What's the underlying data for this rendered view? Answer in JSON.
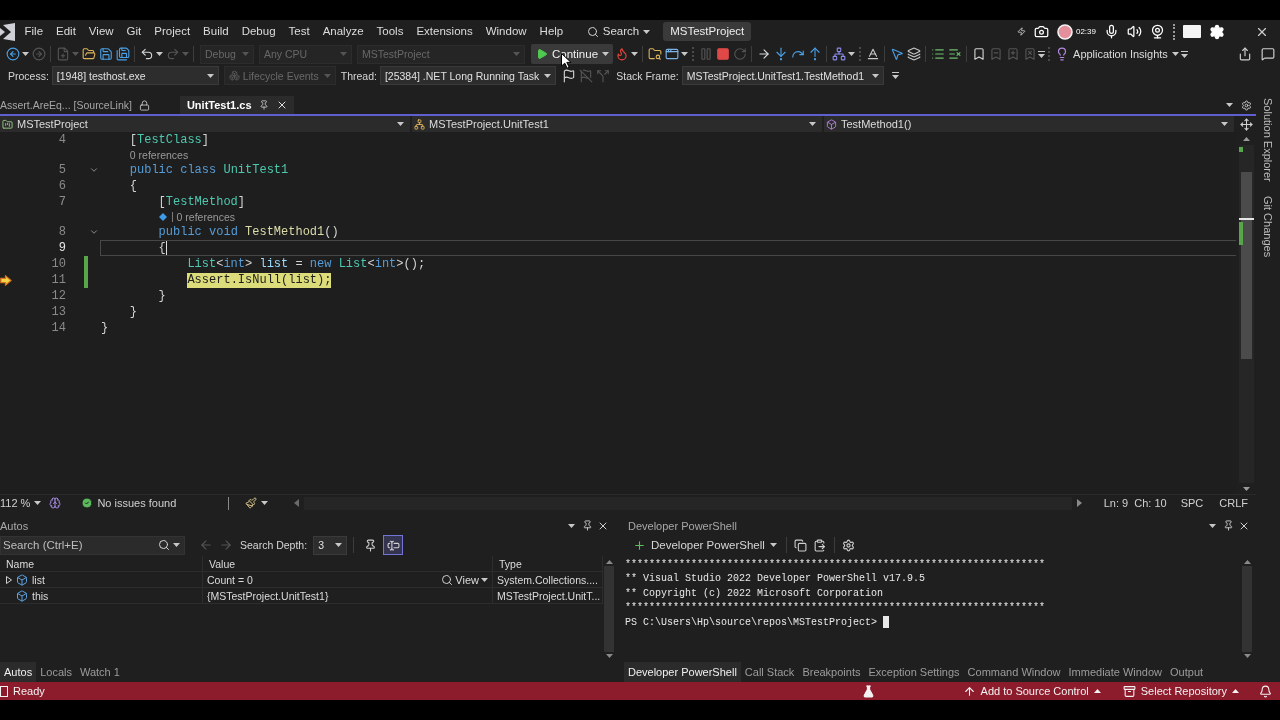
{
  "menu_bar": {
    "items": [
      "File",
      "Edit",
      "View",
      "Git",
      "Project",
      "Build",
      "Debug",
      "Test",
      "Analyze",
      "Tools",
      "Extensions",
      "Window",
      "Help"
    ],
    "search": "Search",
    "title": "MSTestProject"
  },
  "recorder": {
    "time": "02:39"
  },
  "toolbar": {
    "nav_groups": [
      [
        {
          "kind": "back",
          "dropdown": true,
          "disabled": false
        },
        {
          "kind": "forward",
          "disabled": true
        }
      ],
      [
        {
          "kind": "new",
          "dropdown": true,
          "disabled": true
        },
        {
          "kind": "open",
          "disabled": false
        },
        {
          "kind": "save",
          "disabled": false
        },
        {
          "kind": "save_all",
          "disabled": false
        }
      ],
      [
        {
          "kind": "undo",
          "dropdown": true,
          "disabled": false
        },
        {
          "kind": "redo",
          "dropdown": true,
          "disabled": true
        }
      ]
    ],
    "combos": [
      {
        "value": "Debug",
        "disabled": true
      },
      {
        "value": "Any CPU",
        "disabled": true
      },
      {
        "value": "MSTestProject",
        "disabled": true
      }
    ],
    "continue": "Continue",
    "debug_groups": [
      [
        {
          "kind": "hot_reload",
          "dropdown": true,
          "disabled": false
        }
      ],
      [
        {
          "kind": "browse",
          "disabled": false
        },
        {
          "kind": "window",
          "dropdown": true,
          "disabled": false
        }
      ],
      [
        {
          "kind": "pause",
          "disabled": true
        },
        {
          "kind": "stop",
          "disabled": false
        },
        {
          "kind": "restart",
          "disabled": true
        }
      ],
      [
        {
          "kind": "next_statement",
          "disabled": false
        },
        {
          "kind": "step_into",
          "disabled": false
        },
        {
          "kind": "step_over",
          "disabled": false
        },
        {
          "kind": "step_out",
          "disabled": false
        }
      ],
      [
        {
          "kind": "map",
          "dropdown": true,
          "disabled": false
        }
      ],
      [
        {
          "kind": "spell",
          "disabled": false
        }
      ],
      [
        {
          "kind": "pointer",
          "disabled": false
        },
        {
          "kind": "stack",
          "disabled": false
        }
      ],
      [
        {
          "kind": "comment",
          "disabled": false
        },
        {
          "kind": "uncomment",
          "disabled": false
        }
      ],
      [
        {
          "kind": "bookmark",
          "disabled": false
        },
        {
          "kind": "bookmark_prev",
          "disabled": true
        },
        {
          "kind": "bookmark_next",
          "disabled": true
        },
        {
          "kind": "bookmark_clear",
          "disabled": true
        }
      ]
    ],
    "insights": "Application Insights"
  },
  "debug_location": {
    "process_label": "Process:",
    "process": "[1948] testhost.exe",
    "lifecycle": {
      "label": "Lifecycle Events",
      "disabled": true
    },
    "thread_label": "Thread:",
    "thread": "[25384] .NET Long Running Task",
    "thread_buttons": [
      {
        "kind": "flag",
        "disabled": false
      },
      {
        "kind": "flag_threads",
        "disabled": true
      },
      {
        "kind": "threads",
        "disabled": true
      }
    ],
    "frame_label": "Stack Frame:",
    "frame": "MSTestProject.UnitTest1.TestMethod1"
  },
  "document_tabs": [
    {
      "label": "Assert.AreEq... [SourceLink]",
      "selected": false,
      "read_only": true
    },
    {
      "label": "UnitTest1.cs",
      "selected": true,
      "read_only": false
    }
  ],
  "navigation_bar": {
    "project": "MSTestProject",
    "type": "MSTestProject.UnitTest1",
    "member": "TestMethod1()"
  },
  "editor": {
    "lines": [
      {
        "kind": "code",
        "number": "4",
        "tokens": [
          {
            "kind": "punct",
            "text": "    ["
          },
          {
            "kind": "type",
            "text": "TestClass"
          },
          {
            "kind": "punct",
            "text": "]"
          }
        ],
        "fold": false,
        "changed": false,
        "current": false,
        "caret": false
      },
      {
        "kind": "lens",
        "text": "0 references",
        "test": false
      },
      {
        "kind": "code",
        "number": "5",
        "tokens": [
          {
            "kind": "keyword",
            "text": "    public "
          },
          {
            "kind": "keyword",
            "text": "class "
          },
          {
            "kind": "type",
            "text": "UnitTest1"
          }
        ],
        "fold": true,
        "changed": false,
        "current": false,
        "caret": false
      },
      {
        "kind": "code",
        "number": "6",
        "tokens": [
          {
            "kind": "punct",
            "text": "    {"
          }
        ],
        "fold": false,
        "changed": false,
        "current": false,
        "caret": false
      },
      {
        "kind": "code",
        "number": "7",
        "tokens": [
          {
            "kind": "punct",
            "text": "        ["
          },
          {
            "kind": "type",
            "text": "TestMethod"
          },
          {
            "kind": "punct",
            "text": "]"
          }
        ],
        "fold": false,
        "changed": false,
        "current": false,
        "caret": false
      },
      {
        "kind": "lens",
        "text": "0 references",
        "test": true
      },
      {
        "kind": "code",
        "number": "8",
        "tokens": [
          {
            "kind": "keyword",
            "text": "        public "
          },
          {
            "kind": "keyword",
            "text": "void "
          },
          {
            "kind": "method",
            "text": "TestMethod1"
          },
          {
            "kind": "punct",
            "text": "()"
          }
        ],
        "fold": true,
        "changed": false,
        "current": false,
        "caret": false
      },
      {
        "kind": "code",
        "number": "9",
        "tokens": [
          {
            "kind": "punct",
            "text": "        {"
          }
        ],
        "fold": false,
        "changed": false,
        "current": false,
        "caret": true
      },
      {
        "kind": "code",
        "number": "10",
        "tokens": [
          {
            "kind": "type",
            "text": "            List"
          },
          {
            "kind": "punct",
            "text": "<"
          },
          {
            "kind": "keyword",
            "text": "int"
          },
          {
            "kind": "punct",
            "text": "> "
          },
          {
            "kind": "variable",
            "text": "list"
          },
          {
            "kind": "punct",
            "text": " = "
          },
          {
            "kind": "keyword",
            "text": "new "
          },
          {
            "kind": "type",
            "text": "List"
          },
          {
            "kind": "punct",
            "text": "<"
          },
          {
            "kind": "keyword",
            "text": "int"
          },
          {
            "kind": "punct",
            "text": ">();"
          }
        ],
        "fold": false,
        "changed": true,
        "current": false,
        "caret": false
      },
      {
        "kind": "code",
        "number": "11",
        "tokens": [
          {
            "kind": "type",
            "text": "            Assert"
          },
          {
            "kind": "punct",
            "text": "."
          },
          {
            "kind": "method",
            "text": "IsNull"
          },
          {
            "kind": "punct",
            "text": "("
          },
          {
            "kind": "variable",
            "text": "list"
          },
          {
            "kind": "punct",
            "text": ");"
          }
        ],
        "fold": false,
        "changed": true,
        "current": true,
        "caret": false
      },
      {
        "kind": "code",
        "number": "12",
        "tokens": [
          {
            "kind": "punct",
            "text": "        }"
          }
        ],
        "fold": false,
        "changed": false,
        "current": false,
        "caret": false
      },
      {
        "kind": "code",
        "number": "13",
        "tokens": [
          {
            "kind": "punct",
            "text": "    }"
          }
        ],
        "fold": false,
        "changed": false,
        "current": false,
        "caret": false
      },
      {
        "kind": "code",
        "number": "14",
        "tokens": [
          {
            "kind": "punct",
            "text": "}"
          }
        ],
        "fold": false,
        "changed": false,
        "current": false,
        "caret": false
      }
    ]
  },
  "editor_status": {
    "zoom": "112 %",
    "issues": "No issues found",
    "line": "Ln: 9",
    "column": "Ch: 10",
    "whitespace": "SPC",
    "line_ending": "CRLF"
  },
  "autos": {
    "title": "Autos",
    "search_placeholder": "Search (Ctrl+E)",
    "nav_buttons": [
      {
        "kind": "back_arrow",
        "disabled": true
      },
      {
        "kind": "forward_arrow",
        "disabled": true
      }
    ],
    "depth_label": "Search Depth:",
    "depth": "3",
    "toggles": [
      {
        "kind": "pin",
        "on": false
      },
      {
        "kind": "text",
        "on": true
      }
    ],
    "columns": [
      "Name",
      "Value",
      "Type"
    ],
    "rows": [
      {
        "name": "list",
        "value": "Count = 0",
        "type": "System.Collections....",
        "expandable": true,
        "visualizer": "View"
      },
      {
        "name": "this",
        "value": "{MSTestProject.UnitTest1}",
        "type": "MSTestProject.UnitT...",
        "expandable": false
      }
    ],
    "tabs": [
      {
        "label": "Autos",
        "selected": true
      },
      {
        "label": "Locals",
        "selected": false
      },
      {
        "label": "Watch 1",
        "selected": false
      }
    ]
  },
  "terminal": {
    "title": "Developer PowerShell",
    "profile": "Developer PowerShell",
    "lines": [
      "**********************************************************************",
      "** Visual Studio 2022 Developer PowerShell v17.9.5",
      "** Copyright (c) 2022 Microsoft Corporation",
      "**********************************************************************",
      "PS C:\\Users\\Hp\\source\\repos\\MSTestProject>"
    ],
    "tabs": [
      {
        "label": "Developer PowerShell",
        "selected": true
      },
      {
        "label": "Call Stack",
        "selected": false
      },
      {
        "label": "Breakpoints",
        "selected": false
      },
      {
        "label": "Exception Settings",
        "selected": false
      },
      {
        "label": "Command Window",
        "selected": false
      },
      {
        "label": "Immediate Window",
        "selected": false
      },
      {
        "label": "Output",
        "selected": false
      }
    ]
  },
  "status_bar": {
    "state": "Ready",
    "source_control": "Add to Source Control",
    "repository": "Select Repository"
  },
  "side_tabs": [
    "Solution Explorer",
    "Git Changes"
  ]
}
